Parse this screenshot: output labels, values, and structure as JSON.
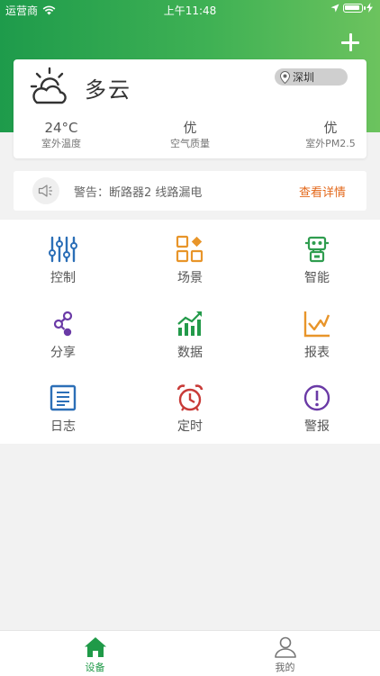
{
  "status_bar": {
    "carrier": "运营商",
    "time": "上午11:48",
    "battery_level": 1.0
  },
  "header": {
    "add_icon": "plus-icon",
    "bg_color_start": "#1e9b4b",
    "bg_color_end": "#6cc35e"
  },
  "weather": {
    "icon": "partly-cloudy-icon",
    "condition": "多云",
    "location": "深圳",
    "stats": [
      {
        "value": "24°C",
        "label": "室外温度"
      },
      {
        "value": "优",
        "label": "空气质量"
      },
      {
        "value": "优",
        "label": "室外PM2.5"
      }
    ]
  },
  "alert": {
    "icon": "speaker-icon",
    "text": "警告：断路器2 线路漏电",
    "link": "查看详情",
    "link_color": "#e3681b"
  },
  "features": [
    {
      "label": "控制",
      "icon": "sliders-icon"
    },
    {
      "label": "场景",
      "icon": "scene-grid-icon"
    },
    {
      "label": "智能",
      "icon": "robot-icon"
    },
    {
      "label": "分享",
      "icon": "share-icon"
    },
    {
      "label": "数据",
      "icon": "bar-chart-icon"
    },
    {
      "label": "报表",
      "icon": "line-chart-icon"
    },
    {
      "label": "日志",
      "icon": "log-icon"
    },
    {
      "label": "定时",
      "icon": "alarm-clock-icon"
    },
    {
      "label": "警报",
      "icon": "alert-icon"
    }
  ],
  "tabbar": {
    "active_color": "#1f9a48",
    "tabs": [
      {
        "label": "设备",
        "icon": "home-icon",
        "active": true
      },
      {
        "label": "我的",
        "icon": "user-icon",
        "active": false
      }
    ]
  }
}
